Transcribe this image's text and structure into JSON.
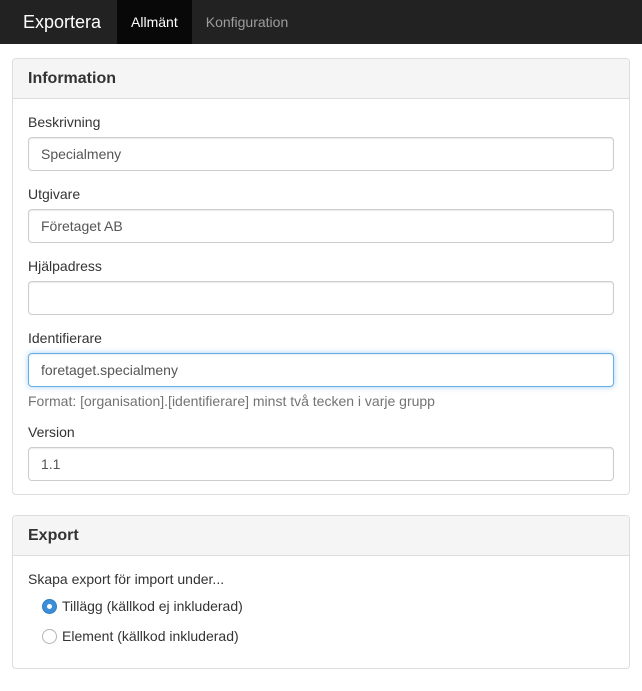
{
  "navbar": {
    "brand": "Exportera",
    "tabs": [
      {
        "label": "Allmänt",
        "active": true
      },
      {
        "label": "Konfiguration",
        "active": false
      }
    ]
  },
  "information": {
    "title": "Information",
    "description": {
      "label": "Beskrivning",
      "value": "Specialmeny"
    },
    "publisher": {
      "label": "Utgivare",
      "value": "Företaget AB"
    },
    "help_address": {
      "label": "Hjälpadress",
      "value": ""
    },
    "identifier": {
      "label": "Identifierare",
      "value": "foretaget.specialmeny",
      "help": "Format: [organisation].[identifierare] minst två tecken i varje grupp"
    },
    "version": {
      "label": "Version",
      "value": "1.1"
    }
  },
  "export": {
    "title": "Export",
    "lead": "Skapa export för import under...",
    "options": [
      {
        "label": "Tillägg (källkod ej inkluderad)",
        "checked": true
      },
      {
        "label": "Element (källkod inkluderad)",
        "checked": false
      }
    ]
  },
  "colors": {
    "navbar": "#222222",
    "active_tab": "#080808",
    "radio_checked": "#3b8ed9",
    "focus_border": "#66afe9"
  }
}
